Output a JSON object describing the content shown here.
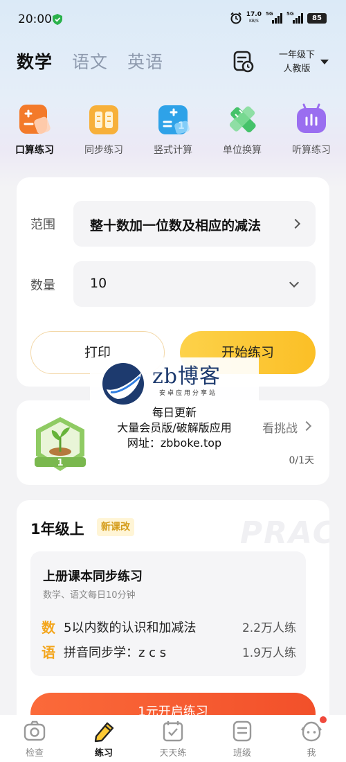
{
  "status_bar": {
    "time": "20:00",
    "net_speed": "17.0",
    "net_unit": "KB/S",
    "sig1_label": "5G",
    "sig2_label": "5G",
    "battery": "85"
  },
  "header": {
    "subjects": [
      "数学",
      "语文",
      "英语"
    ],
    "grade_line1": "一年级下",
    "grade_line2": "人教版"
  },
  "tools": [
    {
      "label": "口算练习",
      "icon": "mental-math-icon",
      "color": "#f37a2a"
    },
    {
      "label": "同步练习",
      "icon": "sync-book-icon",
      "color": "#f7b03a"
    },
    {
      "label": "竖式计算",
      "icon": "vertical-calc-icon",
      "color": "#2ea2e8"
    },
    {
      "label": "单位换算",
      "icon": "unit-ruler-icon",
      "color": "#45c26a"
    },
    {
      "label": "听算练习",
      "icon": "listen-calc-icon",
      "color": "#9a6ef0"
    }
  ],
  "practice": {
    "range_label": "范围",
    "range_value": "整十数加一位数及相应的减法",
    "count_label": "数量",
    "count_value": "10",
    "print_label": "打印",
    "start_label": "开始练习"
  },
  "challenge": {
    "badge_level": "1",
    "link_text": "看挑战",
    "progress": "0/1天"
  },
  "watermark": {
    "brand": "zb博客",
    "sub": "安卓应用分享站",
    "line1": "每日更新",
    "line2": "大量会员版/破解版应用",
    "line3": "网址：zbboke.top"
  },
  "grade_section": {
    "title": "1年级上",
    "tag": "新课改",
    "bg_text": "PRAC",
    "sync_title": "上册课本同步练习",
    "sync_sub": "数学、语文每日10分钟",
    "items": [
      {
        "subject": "数",
        "name": "5以内数的认识和加减法",
        "count": "2.2万人练"
      },
      {
        "subject": "语",
        "name": "拼音同步学：z c s",
        "count": "1.9万人练"
      }
    ],
    "open_label": "1元开启练习"
  },
  "bottom_nav": [
    {
      "label": "检查",
      "icon": "camera-check-icon"
    },
    {
      "label": "练习",
      "icon": "pencil-practice-icon"
    },
    {
      "label": "天天练",
      "icon": "daily-calendar-icon"
    },
    {
      "label": "班级",
      "icon": "class-icon"
    },
    {
      "label": "我",
      "icon": "profile-face-icon"
    }
  ]
}
